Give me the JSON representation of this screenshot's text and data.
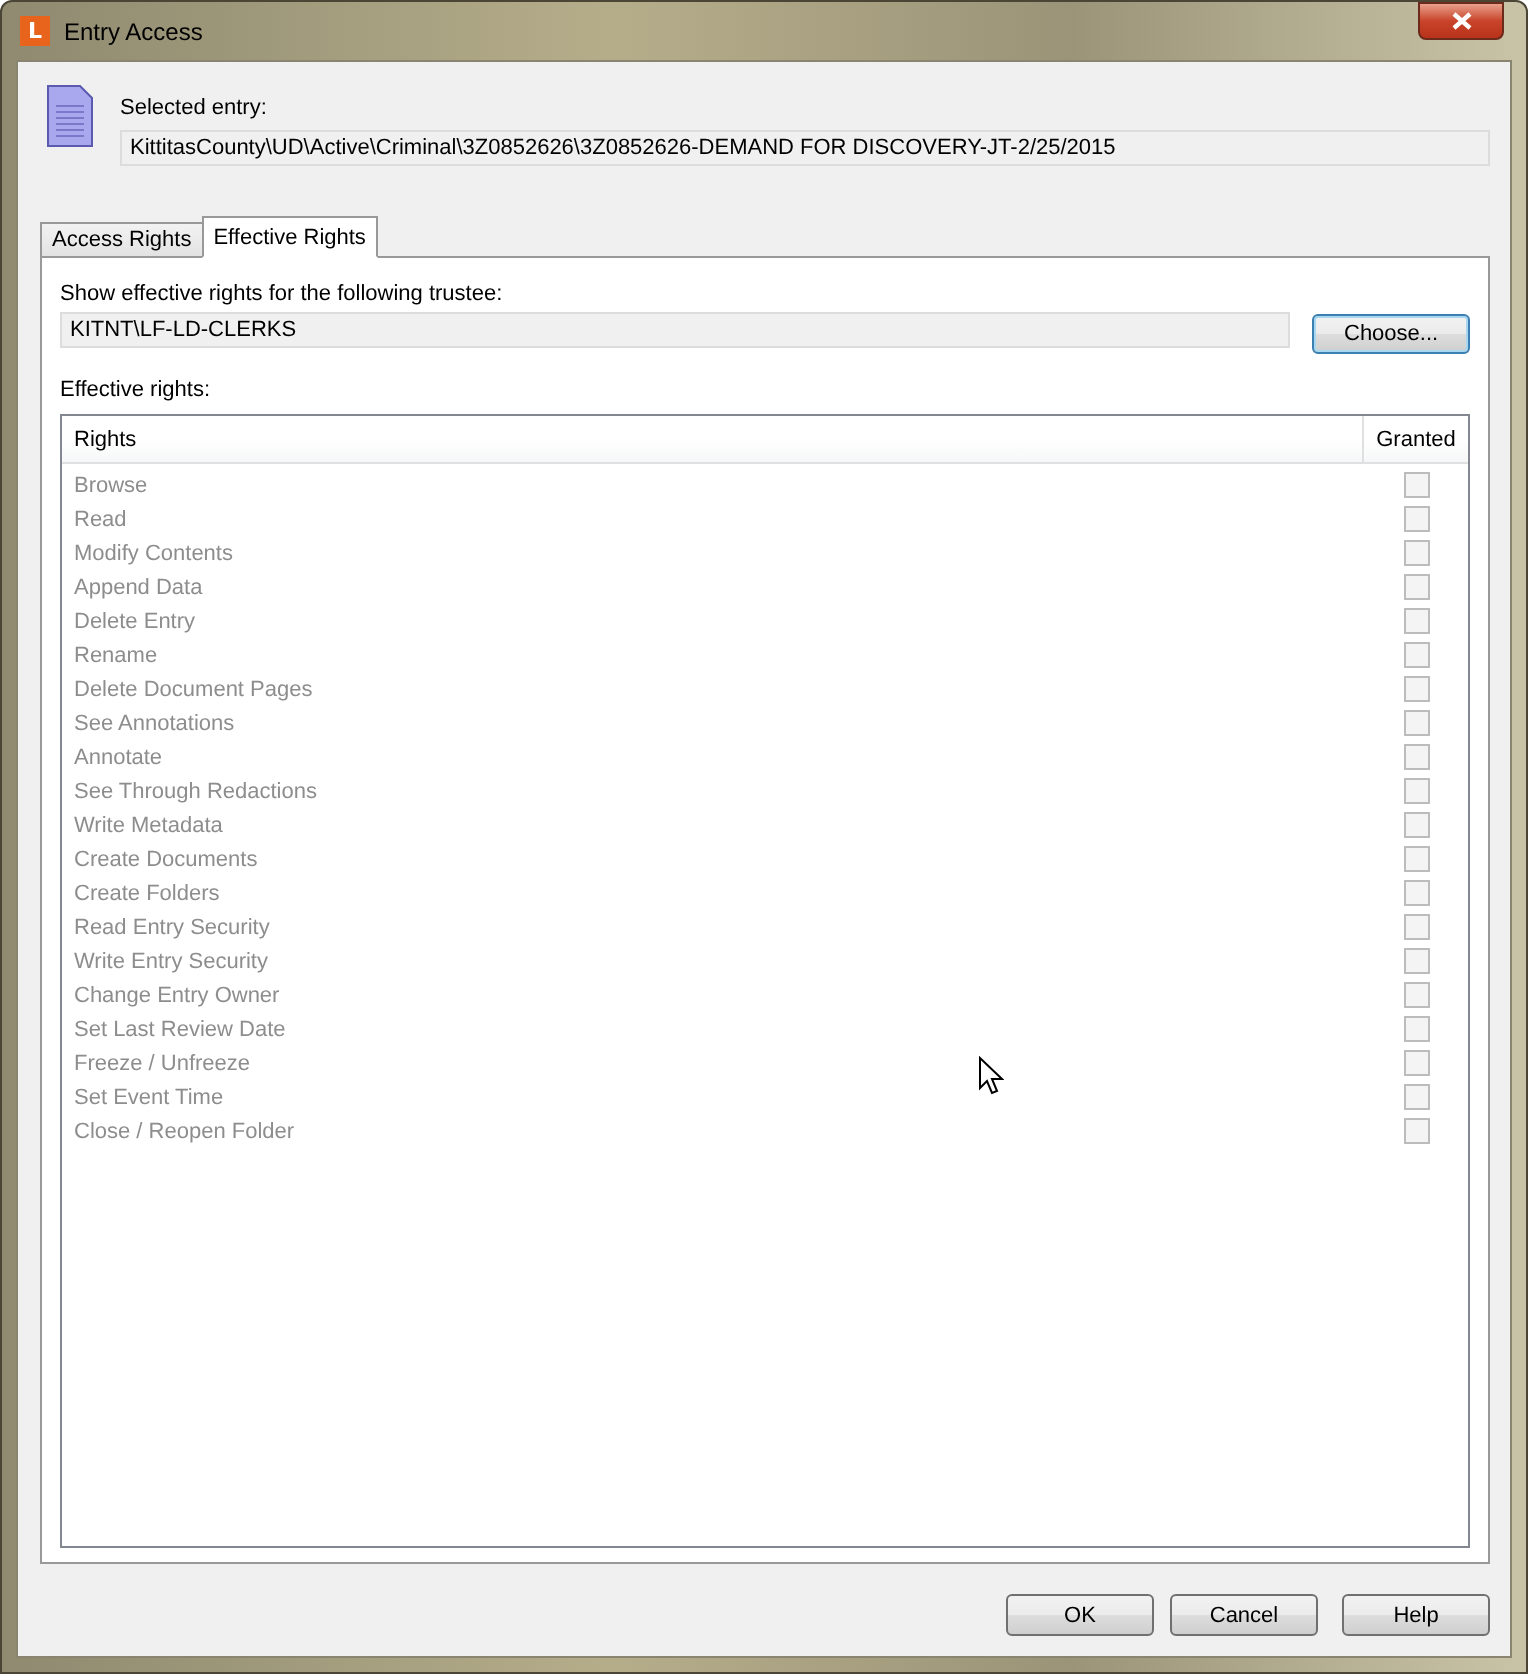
{
  "window": {
    "title": "Entry Access",
    "app_letter": "L"
  },
  "entry": {
    "label": "Selected entry:",
    "value": "KittitasCounty\\UD\\Active\\Criminal\\3Z0852626\\3Z0852626-DEMAND FOR DISCOVERY-JT-2/25/2015"
  },
  "tabs": [
    {
      "label": "Access Rights",
      "selected": false
    },
    {
      "label": "Effective Rights",
      "selected": true
    }
  ],
  "trustee": {
    "label": "Show effective rights for the following trustee:",
    "value": "KITNT\\LF-LD-CLERKS",
    "button": "Choose..."
  },
  "rights_label": "Effective rights:",
  "table": {
    "disabled": true,
    "columns": [
      "Rights",
      "Granted"
    ],
    "rows": [
      {
        "name": "Browse",
        "checked": false
      },
      {
        "name": "Read",
        "checked": false
      },
      {
        "name": "Modify Contents",
        "checked": false
      },
      {
        "name": "Append Data",
        "checked": false
      },
      {
        "name": "Delete Entry",
        "checked": false
      },
      {
        "name": "Rename",
        "checked": false
      },
      {
        "name": "Delete Document Pages",
        "checked": false
      },
      {
        "name": "See Annotations",
        "checked": false
      },
      {
        "name": "Annotate",
        "checked": false
      },
      {
        "name": "See Through Redactions",
        "checked": false
      },
      {
        "name": "Write Metadata",
        "checked": false
      },
      {
        "name": "Create Documents",
        "checked": false
      },
      {
        "name": "Create Folders",
        "checked": false
      },
      {
        "name": "Read Entry Security",
        "checked": false
      },
      {
        "name": "Write Entry Security",
        "checked": false
      },
      {
        "name": "Change Entry Owner",
        "checked": false
      },
      {
        "name": "Set Last Review Date",
        "checked": false
      },
      {
        "name": "Freeze / Unfreeze",
        "checked": false
      },
      {
        "name": "Set Event Time",
        "checked": false
      },
      {
        "name": "Close / Reopen Folder",
        "checked": false
      }
    ]
  },
  "buttons": [
    "OK",
    "Cancel",
    "Help"
  ]
}
